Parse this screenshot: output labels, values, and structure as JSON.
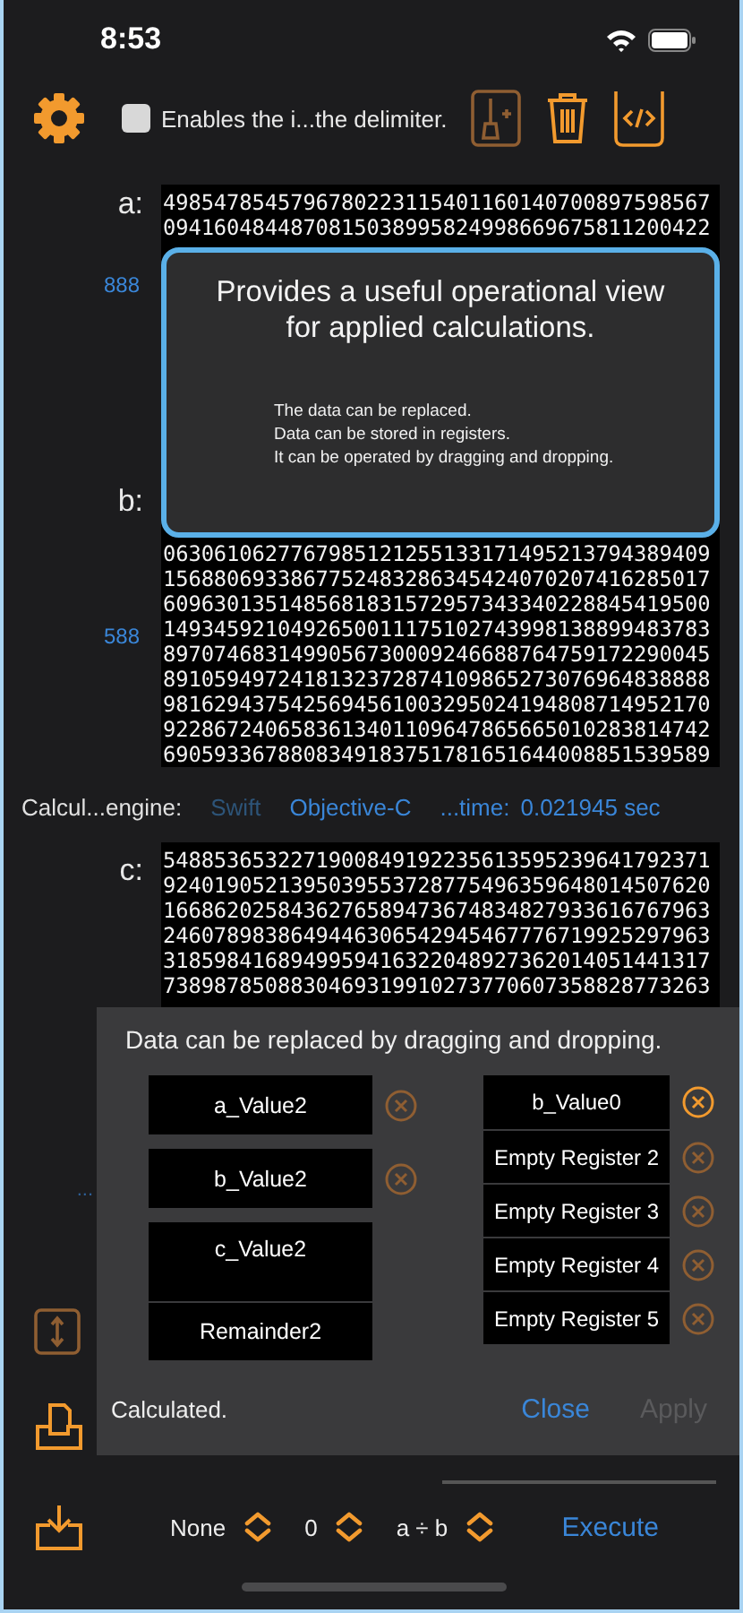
{
  "status_bar": {
    "time": "8:53"
  },
  "toolbar": {
    "checkbox": {
      "label": "Enables the i...the delimiter.",
      "checked": false
    },
    "buttons": [
      {
        "kind": "broom",
        "disabled": true
      },
      {
        "kind": "trash",
        "disabled": false
      },
      {
        "kind": "code",
        "disabled": false
      }
    ]
  },
  "operands": [
    {
      "label": "a:",
      "count": "888",
      "lines": [
        "4985478545796780223115401160140700897598567",
        "0941604844870815038995824998669675811200422"
      ]
    },
    {
      "label": "b:",
      "count": "588",
      "lines": [
        "0630610627767985121255133171495213794389409",
        "1568806933867752483286345424070207416285017",
        "6096301351485681831572957343340228845419500",
        "1493459210492650011175102743998138899483783",
        "8970746831499056730009246688764759172290045",
        "8910594972418132372874109865273076964838888",
        "9816294375425694561003295024194808714952170",
        "9228672406583613401109647865665010283814742",
        "6905933678808349183751781651644008851539589"
      ]
    }
  ],
  "overlay": {
    "title": "Provides a useful operational view for applied calculations.",
    "notes": [
      "The data can be replaced.",
      "Data can be stored in registers.",
      "It can be operated by dragging and dropping."
    ]
  },
  "engine": {
    "label": "Calcul...engine:",
    "options": [
      {
        "label": "Swift",
        "selected": true
      },
      {
        "label": "Objective-C",
        "selected": false
      }
    ],
    "time_label": "...time:",
    "time": "0.021945 sec"
  },
  "result": {
    "label": "c:",
    "count": "...",
    "lines": [
      "5488536532271900849192235613595239641792371",
      "9240190521395039553728775496359648014507620",
      "1668620258436276589473674834827933616767963",
      "2460789838649446306542945467776719925297963",
      "3185984168949959416322048927362014051441317",
      "7389878508830469319910273770607358828773263"
    ]
  },
  "side_tools": [
    {
      "kind": "swap",
      "disabled": true
    },
    {
      "kind": "tray",
      "disabled": false
    }
  ],
  "dialog": {
    "title": "Data can be replaced by dragging and dropping.",
    "values": [
      {
        "label": "a_Value2",
        "kind": "value",
        "clearable": true
      },
      {
        "label": "b_Value2",
        "kind": "value",
        "clearable": true
      },
      {
        "label": "c_Value2",
        "kind": "tall",
        "clearable": false
      },
      {
        "label": "Remainder2",
        "kind": "attached",
        "clearable": false
      }
    ],
    "registers": [
      {
        "label": "b_Value0",
        "clear_enabled": true
      },
      {
        "label": "Empty Register 2",
        "clear_enabled": false
      },
      {
        "label": "Empty Register 3",
        "clear_enabled": false
      },
      {
        "label": "Empty Register 4",
        "clear_enabled": false
      },
      {
        "label": "Empty Register 5",
        "clear_enabled": false
      }
    ],
    "status": "Calculated.",
    "close": "Close",
    "apply": {
      "label": "Apply",
      "disabled": true
    }
  },
  "bottom_bar": {
    "pickers": [
      "None",
      "0",
      "a ÷ b"
    ],
    "execute": "Execute"
  }
}
